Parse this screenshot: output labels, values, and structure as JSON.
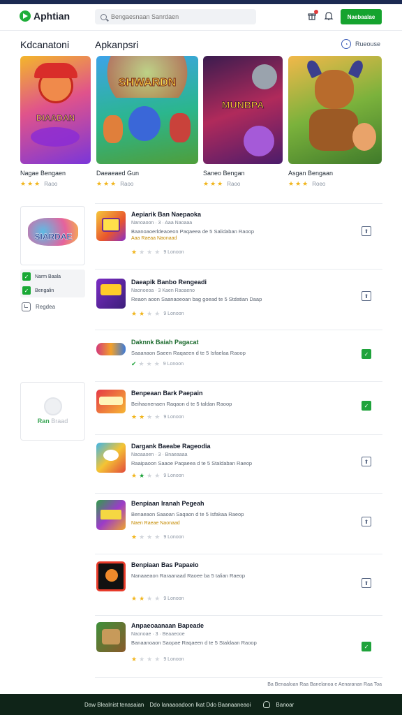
{
  "header": {
    "logo_text": "Aphtian",
    "search_placeholder": "Bengaesnaan Sanrdaen",
    "primary_button": "Naebaalae"
  },
  "sections": {
    "left_title": "Kdcanatoni",
    "main_title": "Apkanpsri",
    "see_all": "Rueouse"
  },
  "featured": [
    {
      "name": "Nagae Bengaen",
      "rating_text": "Raoo",
      "stars": 3,
      "art_title": "DIAADAN"
    },
    {
      "name": "Daeaeaed Gun",
      "rating_text": "Raoo",
      "stars": 3,
      "art_title": "SHWARDN"
    },
    {
      "name": "Saneo Bengan",
      "rating_text": "Raoo",
      "stars": 3,
      "art_title": "MUNBPA"
    },
    {
      "name": "Asgan Bengaan",
      "rating_text": "Roeo",
      "stars": 3,
      "art_title": ""
    }
  ],
  "sidebar": {
    "card_logo": "SIARDAE",
    "filters": [
      {
        "label": "Narm Baala",
        "checked": true
      },
      {
        "label": "Bengalin",
        "checked": true
      }
    ],
    "link": "Regdea",
    "promo_prefix": "Ran",
    "promo_suffix": "Braad"
  },
  "apps": [
    {
      "title": "Aepiarik Ban Naepaoka",
      "meta": "Nanoaoon · 3 · Aaa Naoaaa",
      "desc": "Baanoaoerldeaoeon Paqaeea de 5 Salidaban Raoop",
      "tag": "Aaa Raeaa Naonaad",
      "stars": 1,
      "rating_text": "9 Lonoon",
      "action": "neutral"
    },
    {
      "title": "Daeapik Banbo Rengeadi",
      "meta": "Naonoeoa · 3 Kaen Raoaeno",
      "desc": "Reaon aoon Saanaoeoan bag goead te 5 Stdatian Daap",
      "tag": "",
      "stars": 2,
      "rating_text": "9 Lonoon",
      "action": "neutral"
    },
    {
      "title": "Daknnk Baiah Pagacat",
      "meta": "",
      "desc": "Saaanaon Saeen Raqaeen d te 5 Isfaelaa Raoop",
      "tag": "",
      "stars": 1,
      "rating_text": "9 Lonoon",
      "action": "green"
    },
    {
      "title": "Benpeaan Bark Paepain",
      "meta": "",
      "desc": "Beihaonenaen Raqaon d te 5 taldan Raoop",
      "tag": "",
      "stars": 2,
      "rating_text": "9 Lonoon",
      "action": "green"
    },
    {
      "title": "Dargank Baeabe Rageodia",
      "meta": "Naoaaoen · 3 · Bnaeaaaa",
      "desc": "Raaipaoon Saaoe Paqaeea d te 5 Staldaban Raeop",
      "tag": "",
      "stars": 2,
      "rating_text": "9 Lonoon",
      "action": "neutral"
    },
    {
      "title": "Benpiaan Iranah Pegeah",
      "meta": "",
      "desc": "Benaeaon Saaoan Saqaon d te 5 Isfakaa Raeop",
      "tag": "Naen Raeae Naonaad",
      "stars": 1,
      "rating_text": "9 Lonoon",
      "action": "neutral"
    },
    {
      "title": "Benpiaan Bas Papaeio",
      "meta": "",
      "desc": "Nanaaeaon Raraanaad Raoee ba 5 talian Raeop",
      "tag": "",
      "stars": 2,
      "rating_text": "9 Lonoon",
      "action": "neutral"
    },
    {
      "title": "Anpaeoaanaan Bapeade",
      "meta": "Naonoae · 3 · Beaaeooe",
      "desc": "Banaanoaon Saopae Raqaeen d te 5 Staldaan Raoop",
      "tag": "",
      "stars": 1,
      "rating_text": "9 Lonoon",
      "action": "green"
    }
  ],
  "footer": {
    "note": "Ba Benaaloan Raa Banelanoa e Aenaranan Raa Toa",
    "text1": "Daw Blealnist tenasaian",
    "text2": "Ddo Ianaaoadoon Ikat Ddo Baanaaneaoi",
    "text3": "Banoar"
  },
  "colors": {
    "brand_green": "#15a32e",
    "top_strip": "#1c2a52",
    "footer_bg": "#0f2418",
    "star": "#f1b51c"
  }
}
